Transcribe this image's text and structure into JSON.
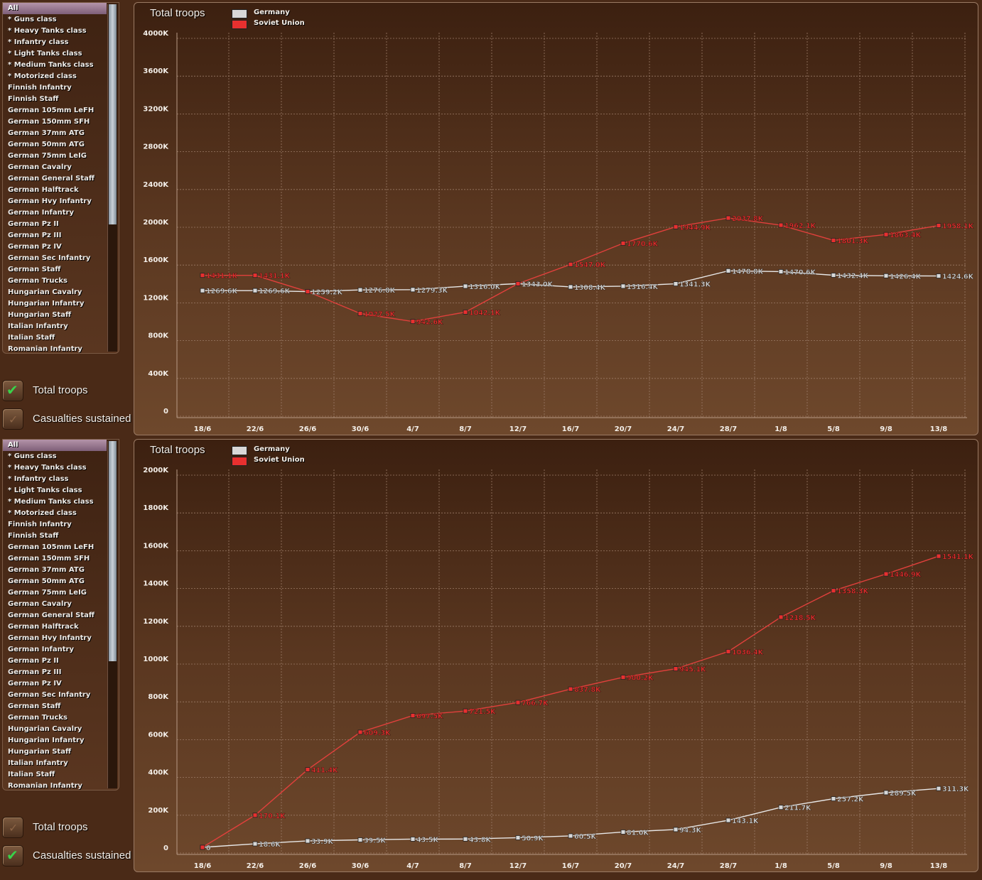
{
  "list_items": [
    "All",
    "* Guns class",
    "* Heavy Tanks class",
    "* Infantry class",
    "* Light Tanks class",
    "* Medium Tanks class",
    "* Motorized class",
    "Finnish Infantry",
    "Finnish Staff",
    "German 105mm LeFH",
    "German 150mm SFH",
    "German 37mm ATG",
    "German 50mm ATG",
    "German 75mm LeIG",
    "German Cavalry",
    "German General Staff",
    "German Halftrack",
    "German Hvy Infantry",
    "German Infantry",
    "German Pz II",
    "German Pz III",
    "German Pz IV",
    "German Sec Infantry",
    "German Staff",
    "German Trucks",
    "Hungarian Cavalry",
    "Hungarian Infantry",
    "Hungarian Staff",
    "Italian Infantry",
    "Italian Staff",
    "Romanian Infantry"
  ],
  "colors": {
    "germany": "#d8d8d8",
    "soviet": "#e8302f",
    "germany_line": "#e8e8e8",
    "soviet_line": "#e0403c"
  },
  "panels": [
    {
      "toggles": [
        {
          "label": "Total troops",
          "checked": true,
          "icon": "check-icon"
        },
        {
          "label": "Casualties sustained",
          "checked": false,
          "icon": "unchecked-icon"
        }
      ],
      "chart_data": {
        "type": "line",
        "title": "Total troops",
        "categories": [
          "18/6",
          "22/6",
          "26/6",
          "30/6",
          "4/7",
          "8/7",
          "12/7",
          "16/7",
          "20/7",
          "24/7",
          "28/7",
          "1/8",
          "5/8",
          "9/8",
          "13/8"
        ],
        "y_ticks": [
          "0",
          "400K",
          "800K",
          "1200K",
          "1600K",
          "2000K",
          "2400K",
          "2800K",
          "3200K",
          "3600K",
          "4000K"
        ],
        "ylim": [
          0,
          4000
        ],
        "grid": true,
        "legend": "top-left",
        "series": [
          {
            "name": "Germany",
            "values": [
              1269.6,
              1269.6,
              1259.2,
              1276.8,
              1279.3,
              1316.0,
              1343.0,
              1308.4,
              1316.4,
              1341.3,
              1478.8,
              1470.6,
              1432.4,
              1426.4,
              1424.6
            ],
            "labels": [
              "1269.6K",
              "1269.6K",
              "1259.2K",
              "1276.8K",
              "1279.3K",
              "1316.0K",
              "1343.0K",
              "1308.4K",
              "1316.4K",
              "1341.3K",
              "1478.8K",
              "1470.6K",
              "1432.4K",
              "1426.4K",
              "1424.6K"
            ]
          },
          {
            "name": "Soviet Union",
            "values": [
              1431.1,
              1431.1,
              1259.2,
              1027.5,
              942.6,
              1042.1,
              1343.0,
              1547.0,
              1770.6,
              1944.9,
              2037.8,
              1962.1,
              1801.3,
              1863.4,
              1958.1
            ],
            "labels": [
              "1431.1K",
              "1431.1K",
              "",
              "1027.5K",
              "942.6K",
              "1042.1K",
              "",
              "1547.0K",
              "1770.6K",
              "1944.9K",
              "2037.8K",
              "1962.1K",
              "1801.3K",
              "1863.4K",
              "1958.1K"
            ]
          }
        ]
      }
    },
    {
      "toggles": [
        {
          "label": "Total troops",
          "checked": false,
          "icon": "unchecked-icon"
        },
        {
          "label": "Casualties sustained",
          "checked": true,
          "icon": "check-icon"
        }
      ],
      "chart_data": {
        "type": "line",
        "title": "Total troops",
        "categories": [
          "18/6",
          "22/6",
          "26/6",
          "30/6",
          "4/7",
          "8/7",
          "12/7",
          "16/7",
          "20/7",
          "24/7",
          "28/7",
          "1/8",
          "5/8",
          "9/8",
          "13/8"
        ],
        "y_ticks": [
          "0",
          "200K",
          "400K",
          "600K",
          "800K",
          "1000K",
          "1200K",
          "1400K",
          "1600K",
          "1800K",
          "2000K"
        ],
        "ylim": [
          0,
          2000
        ],
        "grid": true,
        "legend": "top-left",
        "series": [
          {
            "name": "Germany",
            "values": [
              0,
              18.6,
              33.9,
              39.5,
              43.5,
              43.8,
              50.9,
              60.5,
              81.0,
              94.3,
              143.1,
              211.7,
              257.2,
              289.5,
              311.3
            ],
            "labels": [
              "0",
              "18.6K",
              "33.9K",
              "39.5K",
              "43.5K",
              "43.8K",
              "50.9K",
              "60.5K",
              "81.0K",
              "94.3K",
              "143.1K",
              "211.7K",
              "257.2K",
              "289.5K",
              "311.3K"
            ]
          },
          {
            "name": "Soviet Union",
            "values": [
              0,
              170.1,
              411.4,
              609.3,
              697.5,
              721.5,
              766.7,
              837.8,
              900.2,
              945.1,
              1036.4,
              1218.5,
              1358.3,
              1446.9,
              1541.1
            ],
            "labels": [
              "",
              "170.1K",
              "411.4K",
              "609.3K",
              "697.5K",
              "721.5K",
              "766.7K",
              "837.8K",
              "900.2K",
              "945.1K",
              "1036.4K",
              "1218.5K",
              "1358.3K",
              "1446.9K",
              "1541.1K"
            ]
          }
        ]
      }
    }
  ]
}
